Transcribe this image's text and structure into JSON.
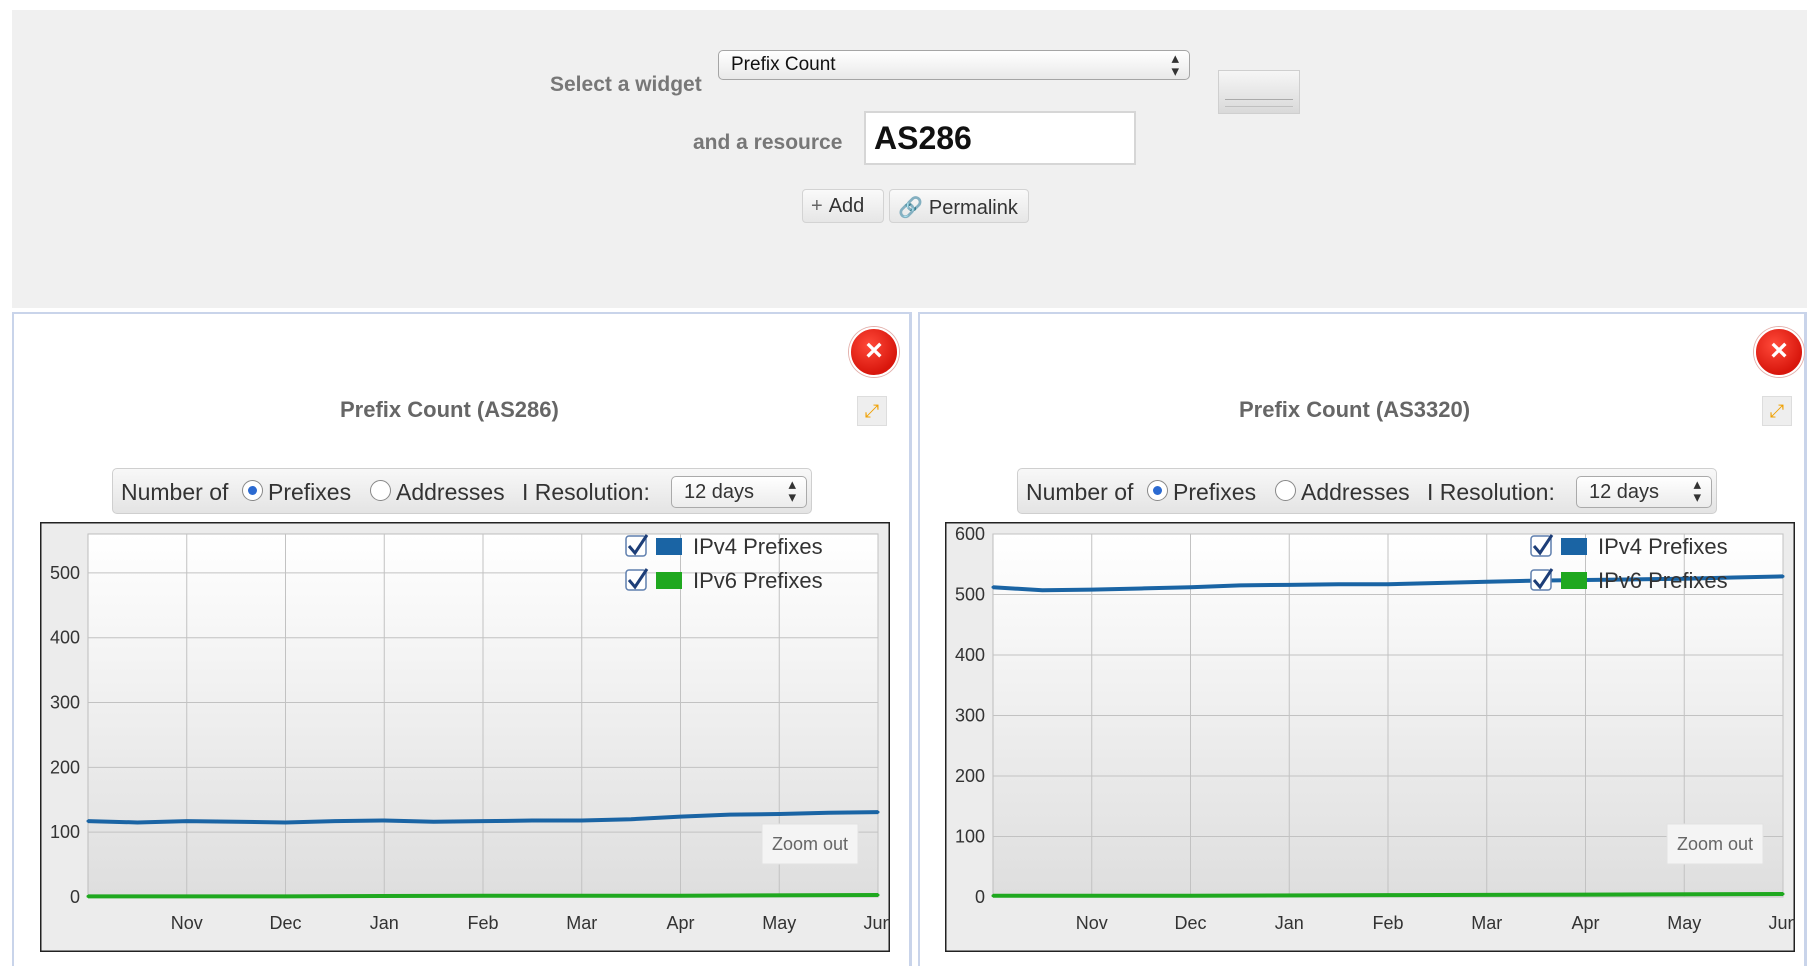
{
  "selector": {
    "widget_label": "Select a widget",
    "widget_value": "Prefix Count",
    "resource_label": "and a resource",
    "resource_value": "AS286",
    "add_label": "Add",
    "permalink_label": "Permalink"
  },
  "widgets": [
    {
      "title": "Prefix Count (AS286)",
      "number_of_label": "Number of",
      "opt_prefixes": "Prefixes",
      "opt_addresses": "Addresses",
      "resolution_label": "I Resolution:",
      "resolution_value": "12 days",
      "zoom_out_label": "Zoom out"
    },
    {
      "title": "Prefix Count (AS3320)",
      "number_of_label": "Number of",
      "opt_prefixes": "Prefixes",
      "opt_addresses": "Addresses",
      "resolution_label": "I Resolution:",
      "resolution_value": "12 days",
      "zoom_out_label": "Zoom out"
    }
  ],
  "colors": {
    "ipv4": "#1a64a4",
    "ipv6": "#1fa81f",
    "close": "#e0241a",
    "panel_border": "#c9d4ea"
  },
  "chart_data": [
    {
      "type": "line",
      "title": "Prefix Count (AS286)",
      "xlabel": "",
      "ylabel": "",
      "x_ticks": [
        "Nov",
        "Dec",
        "Jan",
        "Feb",
        "Mar",
        "Apr",
        "May",
        "Jun"
      ],
      "y_ticks": [
        0,
        100,
        200,
        300,
        400,
        500
      ],
      "ylim": [
        0,
        560
      ],
      "legend_position": "top-right",
      "grid": true,
      "series": [
        {
          "name": "IPv4 Prefixes",
          "color": "#1a64a4",
          "x": [
            0,
            0.5,
            1,
            1.5,
            2,
            2.5,
            3,
            3.5,
            4,
            4.5,
            5,
            5.5,
            6,
            6.5,
            7,
            7.5,
            8
          ],
          "y": [
            117,
            115,
            117,
            116,
            115,
            117,
            118,
            116,
            117,
            118,
            118,
            120,
            124,
            127,
            128,
            130,
            131
          ]
        },
        {
          "name": "IPv6 Prefixes",
          "color": "#1fa81f",
          "x": [
            0,
            2,
            4,
            6,
            8
          ],
          "y": [
            1,
            1,
            2,
            2,
            3
          ]
        }
      ]
    },
    {
      "type": "line",
      "title": "Prefix Count (AS3320)",
      "xlabel": "",
      "ylabel": "",
      "x_ticks": [
        "Nov",
        "Dec",
        "Jan",
        "Feb",
        "Mar",
        "Apr",
        "May",
        "Jun"
      ],
      "y_ticks": [
        0,
        100,
        200,
        300,
        400,
        500,
        600
      ],
      "ylim": [
        0,
        600
      ],
      "legend_position": "top-right",
      "grid": true,
      "series": [
        {
          "name": "IPv4 Prefixes",
          "color": "#1a64a4",
          "x": [
            0,
            0.5,
            1,
            1.5,
            2,
            2.5,
            3,
            3.5,
            4,
            4.5,
            5,
            5.5,
            6,
            6.5,
            7,
            7.5,
            8
          ],
          "y": [
            512,
            507,
            508,
            510,
            512,
            515,
            516,
            517,
            517,
            519,
            521,
            523,
            524,
            525,
            526,
            528,
            530
          ]
        },
        {
          "name": "IPv6 Prefixes",
          "color": "#1fa81f",
          "x": [
            0,
            2,
            4,
            6,
            8
          ],
          "y": [
            2,
            2,
            3,
            4,
            5
          ]
        }
      ]
    }
  ]
}
